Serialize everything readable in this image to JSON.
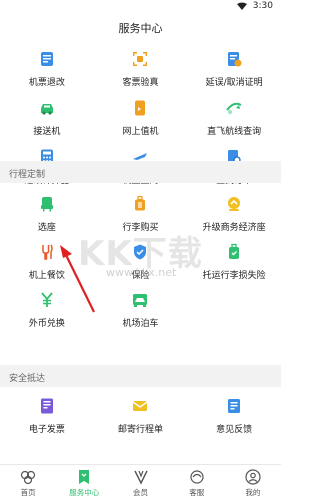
{
  "status": {
    "time": "3:30"
  },
  "page_title": "服务中心",
  "group1": [
    {
      "label": "机票退改",
      "icon": "ticket-refund-icon",
      "color": "#3a8ee6"
    },
    {
      "label": "客票验真",
      "icon": "ticket-verify-icon",
      "color": "#f0a020"
    },
    {
      "label": "延误/取消证明",
      "icon": "delay-certificate-icon",
      "color": "#3a8ee6"
    },
    {
      "label": "接送机",
      "icon": "car-pickup-icon",
      "color": "#2fbf71"
    },
    {
      "label": "网上值机",
      "icon": "online-checkin-icon",
      "color": "#f0a020"
    },
    {
      "label": "直飞航线查询",
      "icon": "route-search-icon",
      "color": "#2fbf71"
    },
    {
      "label": "退改计算器",
      "icon": "calculator-icon",
      "color": "#3a8ee6"
    },
    {
      "label": "机上上网",
      "icon": "inflight-wifi-icon",
      "color": "#3a8ee6"
    },
    {
      "label": "查找订单",
      "icon": "order-search-icon",
      "color": "#3a8ee6"
    }
  ],
  "section2_title": "行程定制",
  "group2": [
    {
      "label": "选座",
      "icon": "seat-icon",
      "color": "#2fbf71"
    },
    {
      "label": "行李购买",
      "icon": "luggage-icon",
      "color": "#f0a020"
    },
    {
      "label": "升级商务经济座",
      "icon": "upgrade-icon",
      "color": "#f0c020"
    },
    {
      "label": "机上餐饮",
      "icon": "meal-icon",
      "color": "#e85a2a"
    },
    {
      "label": "保险",
      "icon": "insurance-icon",
      "color": "#3a8ee6"
    },
    {
      "label": "托运行李损失险",
      "icon": "baggage-insurance-icon",
      "color": "#2fbf71"
    },
    {
      "label": "外币兑换",
      "icon": "currency-exchange-icon",
      "color": "#2fbf71"
    },
    {
      "label": "机场泊车",
      "icon": "parking-icon",
      "color": "#2fbf71"
    }
  ],
  "section3_title": "安全抵达",
  "group3": [
    {
      "label": "电子发票",
      "icon": "e-invoice-icon",
      "color": "#7a5ad8"
    },
    {
      "label": "邮寄行程单",
      "icon": "mail-itinerary-icon",
      "color": "#f0c020"
    },
    {
      "label": "意见反馈",
      "icon": "feedback-icon",
      "color": "#3a8ee6"
    }
  ],
  "watermark": {
    "brand": "KK下载",
    "url": "www.kkx.net"
  },
  "tabs": [
    {
      "label": "首页",
      "icon": "home-icon",
      "active": false
    },
    {
      "label": "服务中心",
      "icon": "service-center-icon",
      "active": true
    },
    {
      "label": "会员",
      "icon": "member-icon",
      "active": false
    },
    {
      "label": "客服",
      "icon": "customer-service-icon",
      "active": false
    },
    {
      "label": "我的",
      "icon": "profile-icon",
      "active": false
    }
  ],
  "colors": {
    "accent": "#2fbf71",
    "section_bg": "#f2f2f2",
    "arrow": "#e02020"
  }
}
